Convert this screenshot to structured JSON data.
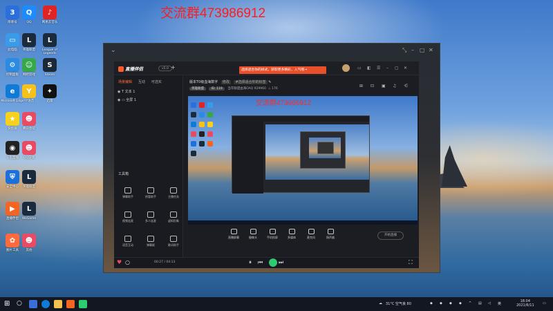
{
  "watermark_text": "交流群473986912",
  "desktop_icons": [
    {
      "label": "哆哆号",
      "bg": "#2a6fdc",
      "glyph": "3"
    },
    {
      "label": "QQ",
      "bg": "#1e8cff",
      "glyph": "Q"
    },
    {
      "label": "网易云音乐",
      "bg": "#e02424",
      "glyph": "♪"
    },
    {
      "label": "此电脑",
      "bg": "#3a9be8",
      "glyph": "▭"
    },
    {
      "label": "英雄联盟",
      "bg": "#1b2b3e",
      "glyph": "L"
    },
    {
      "label": "League of Legends",
      "bg": "#1b2b3e",
      "glyph": "L"
    },
    {
      "label": "控制面板",
      "bg": "#2a8be0",
      "glyph": "⚙"
    },
    {
      "label": "网吧游戏",
      "bg": "#36a84a",
      "glyph": "☺"
    },
    {
      "label": "Steam",
      "bg": "#1b2838",
      "glyph": "S"
    },
    {
      "label": "Microsoft Edge",
      "bg": "#0f7bd6",
      "glyph": "e"
    },
    {
      "label": "YY语音",
      "bg": "#f4c21b",
      "glyph": "Y"
    },
    {
      "label": "迅雷",
      "bg": "#111",
      "glyph": "✦"
    },
    {
      "label": "快剪辑",
      "bg": "#f6d21c",
      "glyph": "★"
    },
    {
      "label": "腾讯会议",
      "bg": "#e84b64",
      "glyph": "☻"
    },
    {
      "label": "斗鱼直播",
      "bg": "#222",
      "glyph": "◉"
    },
    {
      "label": "QQ游戏",
      "bg": "#e84b64",
      "glyph": "☻"
    },
    {
      "label": "安全中心",
      "bg": "#1e70d9",
      "glyph": "⛨"
    },
    {
      "label": "英雄联盟",
      "bg": "#1b2b3e",
      "glyph": "L"
    },
    {
      "label": "直播伴侣",
      "bg": "#f26522",
      "glyph": "▶"
    },
    {
      "label": "WeGame",
      "bg": "#1b2b3e",
      "glyph": "L"
    },
    {
      "label": "图片工具",
      "bg": "#ff6a3c",
      "glyph": "✿"
    },
    {
      "label": "其他",
      "bg": "#e84b64",
      "glyph": "☻"
    }
  ],
  "app": {
    "logo_text": "直播伴侣",
    "version_badge": "v5.0",
    "promo_text": "选择适合你的样式，获取更多精彩，入气哦→",
    "tabs": [
      "场景编辑",
      "互动",
      "可选实"
    ],
    "sources": [
      "文本 1",
      "全屏 1"
    ],
    "tools_title": "工具箱",
    "tools": [
      {
        "label": "弹幕助手"
      },
      {
        "label": "房管助手"
      },
      {
        "label": "主播任务"
      },
      {
        "label": "视频连麦"
      },
      {
        "label": "多人连麦"
      },
      {
        "label": "虚拟形象"
      },
      {
        "label": "语音互动"
      },
      {
        "label": "弹幕姬"
      },
      {
        "label": "歌词助手"
      }
    ],
    "notice_text": "当前直播间暂无法使用弹幕功能",
    "stream_title": "版本T0级血海数字",
    "stream_edit": "修改",
    "stream_tag": "#选择适合你的标签",
    "stream_badge": "英雄联盟",
    "stream_id": "ID: 119",
    "stream_meta": "当年联盟血海OAQ  929960",
    "viewer_count": "176",
    "controls": [
      {
        "label": "直播屏幕"
      },
      {
        "label": "摄像头"
      },
      {
        "label": "手机投屏"
      },
      {
        "label": "多媒体"
      },
      {
        "label": "麦克风"
      },
      {
        "label": "扬声器"
      }
    ],
    "start_button": "开始直播",
    "player_time": "00:27 / 04:13"
  },
  "taskbar": {
    "weather": "31°C 空气良 80",
    "time": "18:04",
    "date": "2021/6/11"
  }
}
